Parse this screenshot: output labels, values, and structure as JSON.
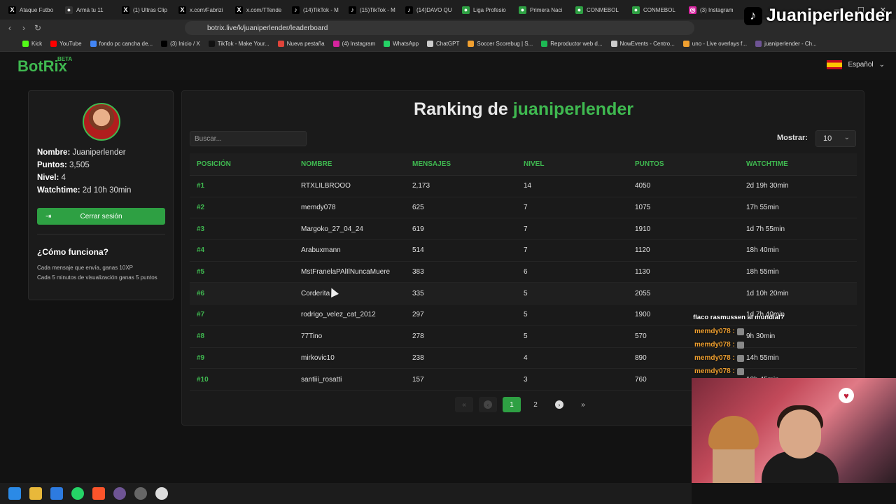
{
  "browser": {
    "tabs": [
      {
        "label": "Ataque Futbo",
        "icon": "x-logo",
        "color": "#000000"
      },
      {
        "label": "Armá tu 11",
        "icon": "github-logo",
        "color": "#333333"
      },
      {
        "label": "(1) Ultras Clip",
        "icon": "x-logo",
        "color": "#000000"
      },
      {
        "label": "x.com/Fabrizi",
        "icon": "x-logo",
        "color": "#000000"
      },
      {
        "label": "x.com/TTende",
        "icon": "x-logo",
        "color": "#000000"
      },
      {
        "label": "(14)TikTok - M",
        "icon": "tiktok-logo",
        "color": "#000000"
      },
      {
        "label": "(15)TikTok - M",
        "icon": "tiktok-logo",
        "color": "#000000"
      },
      {
        "label": "(14)DAVO QU",
        "icon": "tiktok-logo",
        "color": "#000000"
      },
      {
        "label": "Liga Profesio",
        "icon": "globe-icon",
        "color": "#2ea043"
      },
      {
        "label": "Primera Naci",
        "icon": "globe-icon",
        "color": "#2ea043"
      },
      {
        "label": "CONMEBOL",
        "icon": "globe-icon",
        "color": "#2ea043"
      },
      {
        "label": "CONMEBOL",
        "icon": "globe-icon",
        "color": "#2ea043"
      },
      {
        "label": "(3) Instagram",
        "icon": "instagram-logo",
        "color": "#d6249f"
      }
    ],
    "url": "botrix.live/k/juaniperlender/leaderboard",
    "bookmarks": [
      {
        "label": "Kick",
        "color": "#53fc18"
      },
      {
        "label": "YouTube",
        "color": "#ff0000"
      },
      {
        "label": "fondo pc cancha de...",
        "color": "#4285f4"
      },
      {
        "label": "(3) Inicio / X",
        "color": "#000000"
      },
      {
        "label": "TikTok - Make Your...",
        "color": "#111111"
      },
      {
        "label": "Nueva pestaña",
        "color": "#e0443a"
      },
      {
        "label": "(4) Instagram",
        "color": "#d6249f"
      },
      {
        "label": "WhatsApp",
        "color": "#25d366"
      },
      {
        "label": "ChatGPT",
        "color": "#cccccc"
      },
      {
        "label": "Soccer Scorebug | S...",
        "color": "#f0a030"
      },
      {
        "label": "Reproductor web d...",
        "color": "#1db954"
      },
      {
        "label": "NowEvents - Centro...",
        "color": "#cccccc"
      },
      {
        "label": "uno - Live overlays f...",
        "color": "#f0a030"
      },
      {
        "label": "juaniperlender - Ch...",
        "color": "#6e5494"
      }
    ]
  },
  "overlay": {
    "tiktok_name": "Juaniperlender",
    "chat_message": "flaco rasmussen al mundial?",
    "chat_users": [
      "memdy078 :",
      "memdy078 :",
      "memdy078 :",
      "memdy078 :"
    ]
  },
  "site": {
    "logo": "BotRix",
    "beta": "BETA",
    "language": "Español"
  },
  "profile": {
    "nombre_label": "Nombre:",
    "nombre": "Juaniperlender",
    "puntos_label": "Puntos:",
    "puntos": "3,505",
    "nivel_label": "Nivel:",
    "nivel": "4",
    "watchtime_label": "Watchtime:",
    "watchtime": "2d 10h 30min",
    "logout": "Cerrar sesión",
    "how_title": "¿Cómo funciona?",
    "how_line1": "Cada mensaje que envía, ganas 10XP",
    "how_line2": "Cada 5 minutos de visualización ganas 5 puntos"
  },
  "ranking": {
    "title_prefix": "Ranking de",
    "title_name": "juaniperlender",
    "search_placeholder": "Buscar...",
    "show_label": "Mostrar:",
    "show_value": "10",
    "columns": [
      "POSICIÓN",
      "NOMBRE",
      "MENSAJES",
      "NIVEL",
      "PUNTOS",
      "WATCHTIME"
    ],
    "rows": [
      [
        "#1",
        "RTXLILBROOO",
        "2,173",
        "14",
        "4050",
        "2d 19h 30min"
      ],
      [
        "#2",
        "memdy078",
        "625",
        "7",
        "1075",
        "17h 55min"
      ],
      [
        "#3",
        "Margoko_27_04_24",
        "619",
        "7",
        "1910",
        "1d 7h 55min"
      ],
      [
        "#4",
        "Arabuxmann",
        "514",
        "7",
        "1120",
        "18h 40min"
      ],
      [
        "#5",
        "MstFranelaPAlIlNuncaMuere",
        "383",
        "6",
        "1130",
        "18h 55min"
      ],
      [
        "#6",
        "Corderita",
        "335",
        "5",
        "2055",
        "1d 10h 20min"
      ],
      [
        "#7",
        "rodrigo_velez_cat_2012",
        "297",
        "5",
        "1900",
        "1d 7h 40min"
      ],
      [
        "#8",
        "77Tino",
        "278",
        "5",
        "570",
        "9h 30min"
      ],
      [
        "#9",
        "mirkovic10",
        "238",
        "4",
        "890",
        "14h 55min"
      ],
      [
        "#10",
        "santiii_rosatti",
        "157",
        "3",
        "760",
        "12h 45min"
      ]
    ],
    "pages": [
      "1",
      "2"
    ],
    "current_page": "1"
  }
}
